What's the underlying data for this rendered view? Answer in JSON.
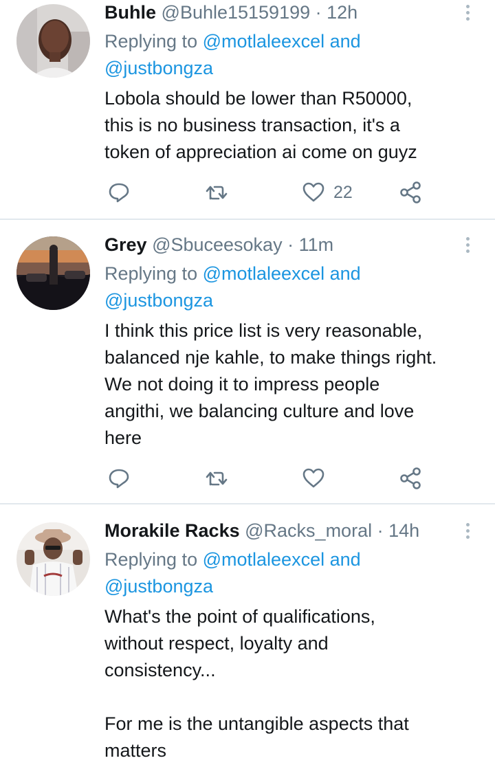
{
  "tweets": [
    {
      "name": "Buhle",
      "handle": "@Buhle15159199",
      "time": "· 12h",
      "replying_prefix": "Replying to",
      "mention1": "@motlaleexcel",
      "and": "and",
      "mention2": "@justbongza",
      "lines": [
        "Lobola should be lower than  R50000,",
        "this is no business transaction, it's a",
        "token of appreciation ai come on guyz"
      ],
      "like_count": "22"
    },
    {
      "name": "Grey",
      "handle": "@Sbuceesokay",
      "time": "· 11m",
      "replying_prefix": "Replying to",
      "mention1": "@motlaleexcel",
      "and": "and",
      "mention2": "@justbongza",
      "lines": [
        "I think this price list is very reasonable,",
        "balanced nje kahle, to make things right.",
        "We not doing it to impress people",
        "angithi, we balancing culture and love",
        "here"
      ],
      "like_count": ""
    },
    {
      "name": "Morakile Racks",
      "handle": "@Racks_moral",
      "time": "· 14h",
      "replying_prefix": "Replying to",
      "mention1": "@motlaleexcel",
      "and": "and",
      "mention2": "@justbongza",
      "lines": [
        "What's the point of qualifications,",
        "without respect, loyalty and",
        "consistency...",
        "",
        "For me is the untangible aspects that",
        "matters"
      ]
    }
  ],
  "icons": [
    "reply-icon",
    "retweet-icon",
    "like-icon",
    "share-icon",
    "more-options-icon"
  ],
  "colors": {
    "name": "#14171a",
    "handle": "#657786",
    "mention": "#1b95e0",
    "icon": "#657786",
    "divider": "#e1e8ed"
  }
}
